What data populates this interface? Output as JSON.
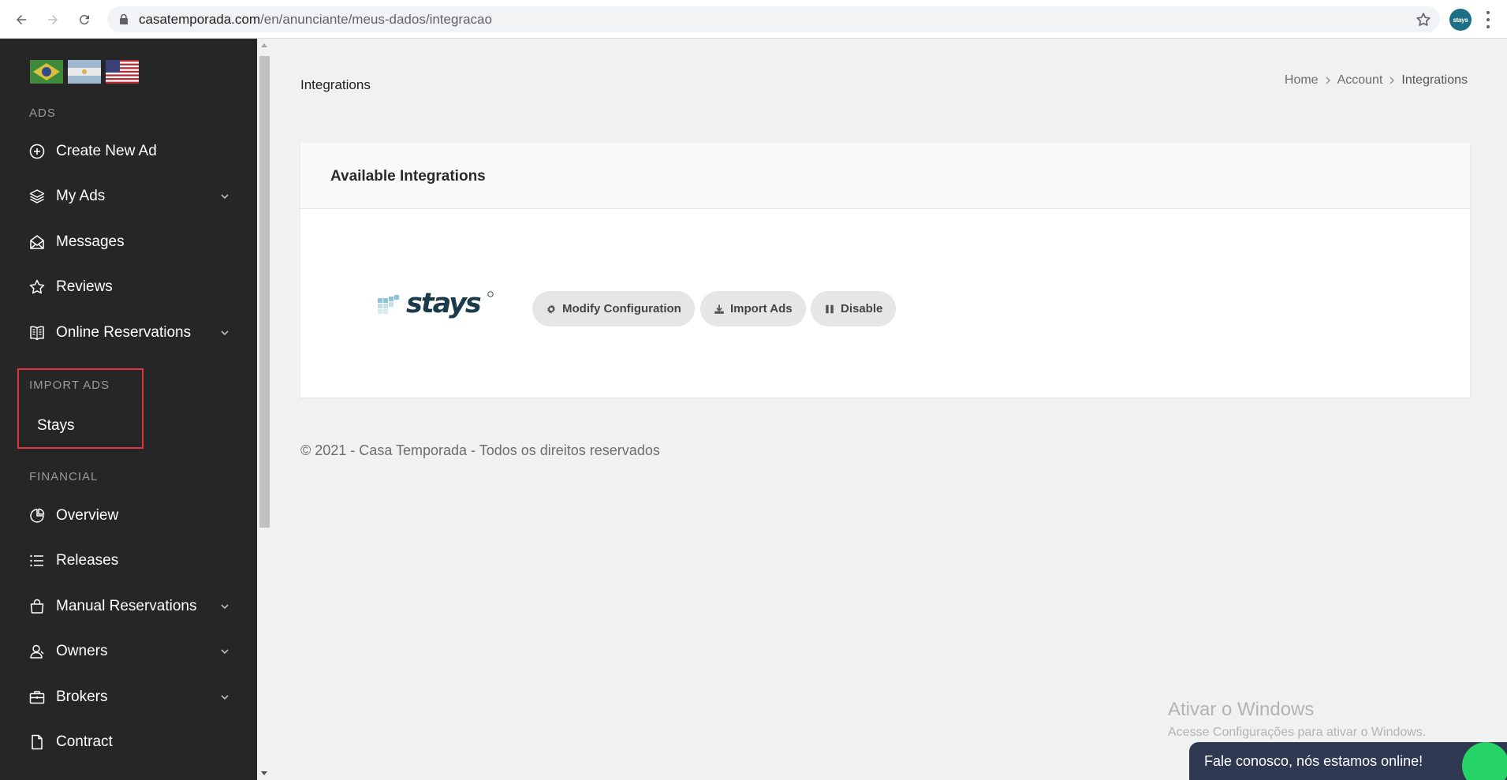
{
  "browser": {
    "url_domain": "casatemporada.com",
    "url_path": "/en/anunciante/meus-dados/integracao",
    "profile_label": "stays"
  },
  "sidebar": {
    "flags": [
      "brazil-flag",
      "argentina-flag",
      "usa-flag"
    ],
    "sections": {
      "ads": "ADS",
      "import_ads": "IMPORT ADS",
      "financial": "FINANCIAL"
    },
    "ads_items": [
      {
        "label": "Create New Ad",
        "icon": "plus-circle-icon",
        "has_chevron": false
      },
      {
        "label": "My Ads",
        "icon": "layers-icon",
        "has_chevron": true
      },
      {
        "label": "Messages",
        "icon": "envelope-open-icon",
        "has_chevron": false
      },
      {
        "label": "Reviews",
        "icon": "star-icon",
        "has_chevron": false
      },
      {
        "label": "Online Reservations",
        "icon": "book-icon",
        "has_chevron": true
      }
    ],
    "import_items": [
      {
        "label": "Stays"
      }
    ],
    "financial_items": [
      {
        "label": "Overview",
        "icon": "pie-chart-icon",
        "has_chevron": false
      },
      {
        "label": "Releases",
        "icon": "list-icon",
        "has_chevron": false
      },
      {
        "label": "Manual Reservations",
        "icon": "shopping-bag-icon",
        "has_chevron": true
      },
      {
        "label": "Owners",
        "icon": "user-icon",
        "has_chevron": true
      },
      {
        "label": "Brokers",
        "icon": "briefcase-icon",
        "has_chevron": true
      },
      {
        "label": "Contract",
        "icon": "document-icon",
        "has_chevron": false
      }
    ]
  },
  "main": {
    "page_title": "Integrations",
    "breadcrumb": [
      "Home",
      "Account",
      "Integrations"
    ],
    "card": {
      "title": "Available Integrations",
      "integration_name": "stays",
      "buttons": [
        {
          "label": "Modify Configuration",
          "icon": "gear-icon"
        },
        {
          "label": "Import Ads",
          "icon": "download-icon"
        },
        {
          "label": "Disable",
          "icon": "pause-icon"
        }
      ]
    },
    "footer": "© 2021 - Casa Temporada - Todos os direitos reservados"
  },
  "overlay": {
    "watermark_title": "Ativar o Windows",
    "watermark_sub": "Acesse Configurações para ativar o Windows.",
    "chat_text": "Fale conosco, nós estamos online!"
  },
  "colors": {
    "sidebar_bg": "#262626",
    "highlight": "#e2343c",
    "chat_bg": "#2e3850",
    "chat_badge": "#25d366"
  }
}
